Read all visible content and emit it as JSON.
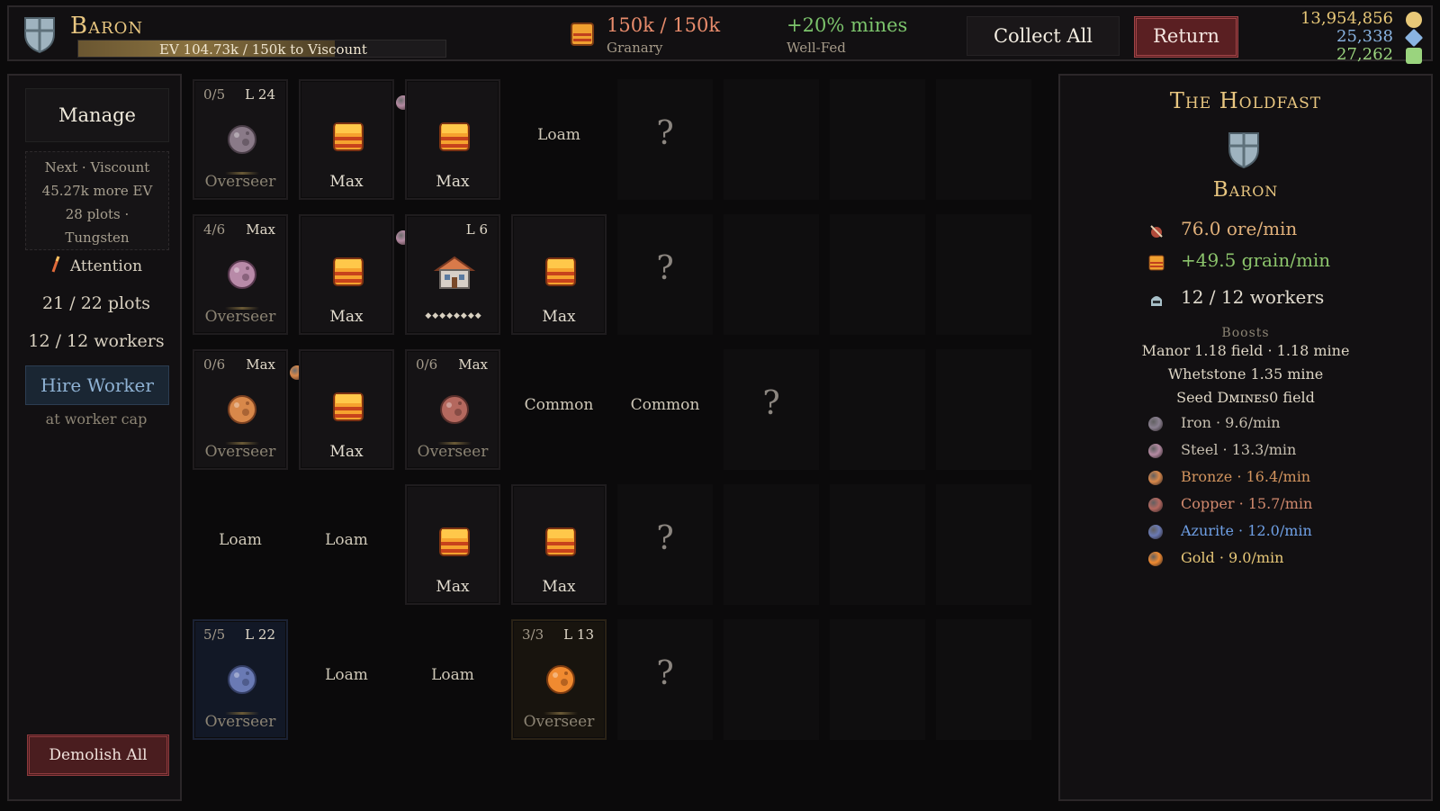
{
  "top_bar": {
    "rank": "Baron",
    "ev_text": "EV 104.73k / 150k to Viscount",
    "ev_fraction": 0.698,
    "granary_value": "150k / 150k",
    "granary_label": "Granary",
    "bonus_value": "+20% mines",
    "bonus_label": "Well-Fed",
    "collect_label": "Collect All",
    "return_label": "Return",
    "currencies": [
      {
        "value": "13,954,856",
        "icon": "gold-coin-icon",
        "color": "#e8c878"
      },
      {
        "value": "25,338",
        "icon": "blue-gem-icon",
        "color": "#8ab4e2"
      },
      {
        "value": "27,262",
        "icon": "green-crystal-icon",
        "color": "#9ad47e"
      }
    ]
  },
  "left_panel": {
    "manage_label": "Manage",
    "next_lines": [
      "Next · Viscount",
      "45.27k more EV",
      "28 plots ·",
      "Tungsten"
    ],
    "attention_label": "Attention",
    "plots": "21 / 22 plots",
    "workers": "12 / 12 workers",
    "hire_label": "Hire Worker",
    "hire_note": "at worker cap",
    "demolish_label": "Demolish All"
  },
  "grid": {
    "rows": [
      [
        {
          "kind": "overseer",
          "tl": "0/5",
          "tr": "L 24",
          "bottom": "Overseer",
          "icon": "iron-ore-icon"
        },
        {
          "kind": "field",
          "bottom": "Max",
          "icon": "grain-field-icon"
        },
        {
          "kind": "field",
          "bottom": "Max",
          "icon": "grain-field-icon",
          "gem": "steel-ore-gem-icon"
        },
        {
          "kind": "label",
          "text": "Loam"
        },
        {
          "kind": "unknown",
          "text": "?"
        },
        {
          "kind": "empty"
        },
        {
          "kind": "empty"
        },
        {
          "kind": "empty"
        }
      ],
      [
        {
          "kind": "overseer",
          "tl": "4/6",
          "tr": "Max",
          "bottom": "Overseer",
          "icon": "steel-ore-icon"
        },
        {
          "kind": "field",
          "bottom": "Max",
          "icon": "grain-field-icon"
        },
        {
          "kind": "manor",
          "tr": "L 6",
          "icon": "manor-house-icon",
          "stones": "◆◆◆◆◆◆◆◆",
          "gem": "steel-ore-gem-icon"
        },
        {
          "kind": "field",
          "bottom": "Max",
          "icon": "grain-field-icon"
        },
        {
          "kind": "unknown",
          "text": "?"
        },
        {
          "kind": "empty"
        },
        {
          "kind": "empty"
        },
        {
          "kind": "empty"
        }
      ],
      [
        {
          "kind": "overseer",
          "tl": "0/6",
          "tr": "Max",
          "bottom": "Overseer",
          "icon": "bronze-ore-icon"
        },
        {
          "kind": "field",
          "bottom": "Max",
          "icon": "grain-field-icon",
          "gem": "bronze-ore-gem-icon"
        },
        {
          "kind": "overseer",
          "tl": "0/6",
          "tr": "Max",
          "bottom": "Overseer",
          "icon": "copper-ore-icon"
        },
        {
          "kind": "label",
          "text": "Common"
        },
        {
          "kind": "label",
          "text": "Common"
        },
        {
          "kind": "unknown",
          "text": "?"
        },
        {
          "kind": "empty"
        },
        {
          "kind": "empty"
        }
      ],
      [
        {
          "kind": "label",
          "text": "Loam"
        },
        {
          "kind": "label",
          "text": "Loam"
        },
        {
          "kind": "field",
          "bottom": "Max",
          "icon": "grain-field-icon",
          "gem": "blue-gem-icon"
        },
        {
          "kind": "field",
          "bottom": "Max",
          "icon": "grain-field-icon",
          "gem": "blue-gem-icon"
        },
        {
          "kind": "unknown",
          "text": "?",
          "gem": "gold-ore-gem-icon"
        },
        {
          "kind": "empty"
        },
        {
          "kind": "empty"
        },
        {
          "kind": "empty"
        }
      ],
      [
        {
          "kind": "overseer",
          "tl": "5/5",
          "tr": "L 22",
          "bottom": "Overseer",
          "icon": "azurite-ore-icon",
          "theme": "blue"
        },
        {
          "kind": "label",
          "text": "Loam"
        },
        {
          "kind": "label",
          "text": "Loam"
        },
        {
          "kind": "overseer",
          "tl": "3/3",
          "tr": "L 13",
          "bottom": "Overseer",
          "icon": "gold-ore-icon",
          "theme": "gold"
        },
        {
          "kind": "unknown",
          "text": "?"
        },
        {
          "kind": "empty"
        },
        {
          "kind": "empty"
        },
        {
          "kind": "empty"
        }
      ]
    ]
  },
  "right_panel": {
    "title": "The Holdfast",
    "rank": "Baron",
    "ore_rate": "76.0 ore/min",
    "grain_rate": "+49.5 grain/min",
    "workers": "12 / 12 workers",
    "boosts_header": "Boosts",
    "boost_lines": [
      "Manor 1.18 field · 1.18 mine",
      "Whetstone 1.35 mine",
      "Seed Dᴍɪɴᴇs0 field"
    ],
    "ores": [
      {
        "label": "Iron · 9.6/min",
        "color": "#c7bfb0",
        "icon": "iron-ore-icon",
        "swatch": "#8a8090"
      },
      {
        "label": "Steel · 13.3/min",
        "color": "#c7bfb0",
        "icon": "steel-ore-icon",
        "swatch": "#b48aa2"
      },
      {
        "label": "Bronze · 16.4/min",
        "color": "#d2945e",
        "icon": "bronze-ore-icon",
        "swatch": "#d8884a"
      },
      {
        "label": "Copper · 15.7/min",
        "color": "#d28a6e",
        "icon": "copper-ore-icon",
        "swatch": "#b46860"
      },
      {
        "label": "Azurite · 12.0/min",
        "color": "#6fa0e6",
        "icon": "azurite-ore-icon",
        "swatch": "#6a7ab4"
      },
      {
        "label": "Gold · 9.0/min",
        "color": "#e8c878",
        "icon": "gold-ore-icon",
        "swatch": "#f08a30"
      }
    ]
  }
}
